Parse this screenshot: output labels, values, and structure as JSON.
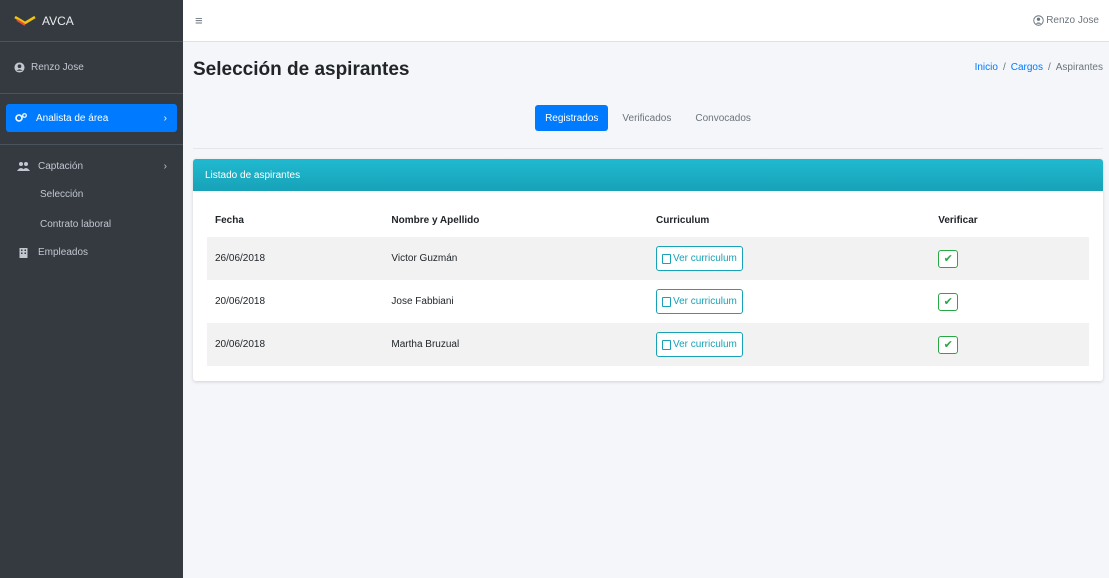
{
  "app": {
    "brand": "AVCA",
    "menu_icon": "hamburger-icon",
    "top_user": "Renzo Jose"
  },
  "sidebar": {
    "user_name": "Renzo Jose",
    "active_item": "Analista de área",
    "items": [
      {
        "label": "Captación",
        "icon": "users-icon"
      },
      {
        "label": "Selección"
      },
      {
        "label": "Contrato laboral"
      },
      {
        "label": "Empleados",
        "icon": "building-icon"
      }
    ]
  },
  "page": {
    "title": "Selección de aspirantes",
    "breadcrumb": [
      "Inicio",
      "Cargos",
      "Aspirantes"
    ]
  },
  "tabs": [
    "Registrados",
    "Verificados",
    "Convocados"
  ],
  "card": {
    "title": "Listado de aspirantes",
    "columns": [
      "Fecha",
      "Nombre y Apellido",
      "Curriculum",
      "Verificar"
    ],
    "button_label": "Ver curriculum",
    "rows": [
      {
        "fecha": "26/06/2018",
        "nombre": "Victor Guzmán"
      },
      {
        "fecha": "20/06/2018",
        "nombre": "Jose Fabbiani"
      },
      {
        "fecha": "20/06/2018",
        "nombre": "Martha Bruzual"
      }
    ]
  },
  "colors": {
    "sidebar_bg": "#343a40",
    "primary": "#007bff",
    "info": "#17a2b8",
    "success": "#28a745"
  }
}
